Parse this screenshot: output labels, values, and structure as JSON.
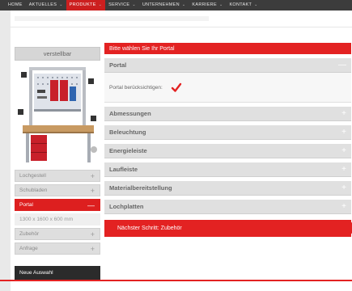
{
  "topnav": {
    "items": [
      {
        "label": "HOME"
      },
      {
        "label": "AKTUELLES"
      },
      {
        "label": "PRODUKTE"
      },
      {
        "label": "SERVICE"
      },
      {
        "label": "UNTERNEHMEN"
      },
      {
        "label": "KARRIERE"
      },
      {
        "label": "KONTAKT"
      }
    ],
    "chevron": "⌄"
  },
  "left": {
    "header": "verstellbar",
    "options": [
      {
        "label": "Lochgestell",
        "pm": "+"
      },
      {
        "label": "Schubladen",
        "pm": "+"
      },
      {
        "label": "Portal",
        "pm": "—"
      },
      {
        "label": "1300 x 1600 x 600 mm",
        "pm": ""
      },
      {
        "label": "Zubehör",
        "pm": "+"
      },
      {
        "label": "Anfrage",
        "pm": "+"
      }
    ],
    "new_button": "Neue Auswahl"
  },
  "right": {
    "banner": "Bitte wählen Sie Ihr Portal",
    "sections": [
      {
        "label": "Portal",
        "pm": "—"
      },
      {
        "label": "Abmessungen",
        "pm": "+"
      },
      {
        "label": "Beleuchtung",
        "pm": "+"
      },
      {
        "label": "Energieleiste",
        "pm": "+"
      },
      {
        "label": "Laufleiste",
        "pm": "+"
      },
      {
        "label": "Materialbereitstellung",
        "pm": "+"
      },
      {
        "label": "Lochplatten",
        "pm": "+"
      }
    ],
    "portal_label": "Portal berücksichtigen:",
    "next_button": "Nächster Schritt: Zubehör"
  },
  "colors": {
    "accent": "#e32222",
    "dark": "#2b2b2b"
  }
}
